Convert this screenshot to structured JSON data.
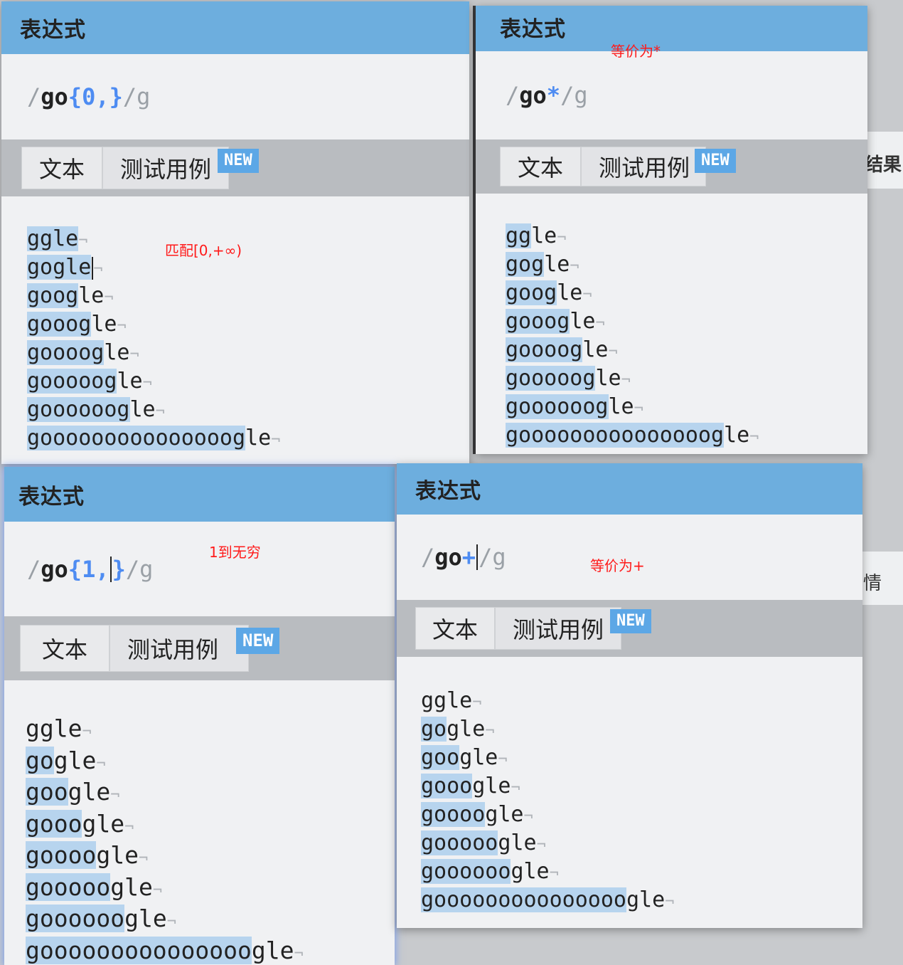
{
  "background": {
    "tab_fragment_1": "结果",
    "tab_fragment_2": "情"
  },
  "panels": [
    {
      "id": "a",
      "header_title": "表达式",
      "expr": {
        "slash": "/",
        "literal": "go",
        "quantifier": "{0,}",
        "quantifier_before_caret": "",
        "quantifier_after_caret": "",
        "flags": "/g"
      },
      "tabs": {
        "text": "文本",
        "tests": "测试用例",
        "badge": "NEW"
      },
      "annotation": "匹配[0,+∞)",
      "lines": [
        {
          "match": "ggle",
          "rest": ""
        },
        {
          "match": "gogle",
          "rest": ""
        },
        {
          "match": "goog",
          "rest": "le"
        },
        {
          "match": "gooog",
          "rest": "le"
        },
        {
          "match": "goooog",
          "rest": "le"
        },
        {
          "match": "gooooog",
          "rest": "le"
        },
        {
          "match": "goooooog",
          "rest": "le"
        },
        {
          "match": "gooooooooooooooog",
          "rest": "le"
        }
      ]
    },
    {
      "id": "b",
      "header_title": "表达式",
      "expr": {
        "slash": "/",
        "literal": "go",
        "quantifier": "*",
        "flags": "/g"
      },
      "tabs": {
        "text": "文本",
        "tests": "测试用例",
        "badge": "NEW"
      },
      "annotation": "等价为*",
      "lines": [
        {
          "match": "gg",
          "rest": "le"
        },
        {
          "match": "gog",
          "rest": "le"
        },
        {
          "match": "goog",
          "rest": "le"
        },
        {
          "match": "gooog",
          "rest": "le"
        },
        {
          "match": "goooog",
          "rest": "le"
        },
        {
          "match": "gooooog",
          "rest": "le"
        },
        {
          "match": "goooooog",
          "rest": "le"
        },
        {
          "match": "gooooooooooooooog",
          "rest": "le"
        }
      ]
    },
    {
      "id": "c",
      "header_title": "表达式",
      "expr": {
        "slash": "/",
        "literal": "go",
        "quantifier_before_caret": "{1,",
        "quantifier_after_caret": "}",
        "flags": "/g"
      },
      "tabs": {
        "text": "文本",
        "tests": "测试用例",
        "badge": "NEW"
      },
      "annotation": "1到无穷",
      "lines": [
        {
          "pre": "ggle",
          "match": "",
          "rest": ""
        },
        {
          "pre": "",
          "match": "go",
          "rest": "gle"
        },
        {
          "pre": "",
          "match": "goo",
          "rest": "gle"
        },
        {
          "pre": "",
          "match": "gooo",
          "rest": "gle"
        },
        {
          "pre": "",
          "match": "goooo",
          "rest": "gle"
        },
        {
          "pre": "",
          "match": "gooooo",
          "rest": "gle"
        },
        {
          "pre": "",
          "match": "goooooo",
          "rest": "gle"
        },
        {
          "pre": "",
          "match": "gooooooooooooooo",
          "rest": "gle"
        }
      ]
    },
    {
      "id": "d",
      "header_title": "表达式",
      "expr": {
        "slash": "/",
        "literal": "go",
        "quantifier": "+",
        "flags": "/g"
      },
      "tabs": {
        "text": "文本",
        "tests": "测试用例",
        "badge": "NEW"
      },
      "annotation": "等价为+",
      "lines": [
        {
          "pre": "ggle",
          "match": "",
          "rest": ""
        },
        {
          "pre": "",
          "match": "go",
          "rest": "gle"
        },
        {
          "pre": "",
          "match": "goo",
          "rest": "gle"
        },
        {
          "pre": "",
          "match": "gooo",
          "rest": "gle"
        },
        {
          "pre": "",
          "match": "goooo",
          "rest": "gle"
        },
        {
          "pre": "",
          "match": "gooooo",
          "rest": "gle"
        },
        {
          "pre": "",
          "match": "goooooo",
          "rest": "gle"
        },
        {
          "pre": "",
          "match": "gooooooooooooooo",
          "rest": "gle"
        }
      ]
    }
  ],
  "newline_glyph": "¬",
  "colors": {
    "header": "#6daede",
    "quantifier": "#4e8cf2",
    "match_highlight": "#b7d4ee",
    "annotation": "#ff1a1a",
    "badge": "#5ca7e6"
  }
}
